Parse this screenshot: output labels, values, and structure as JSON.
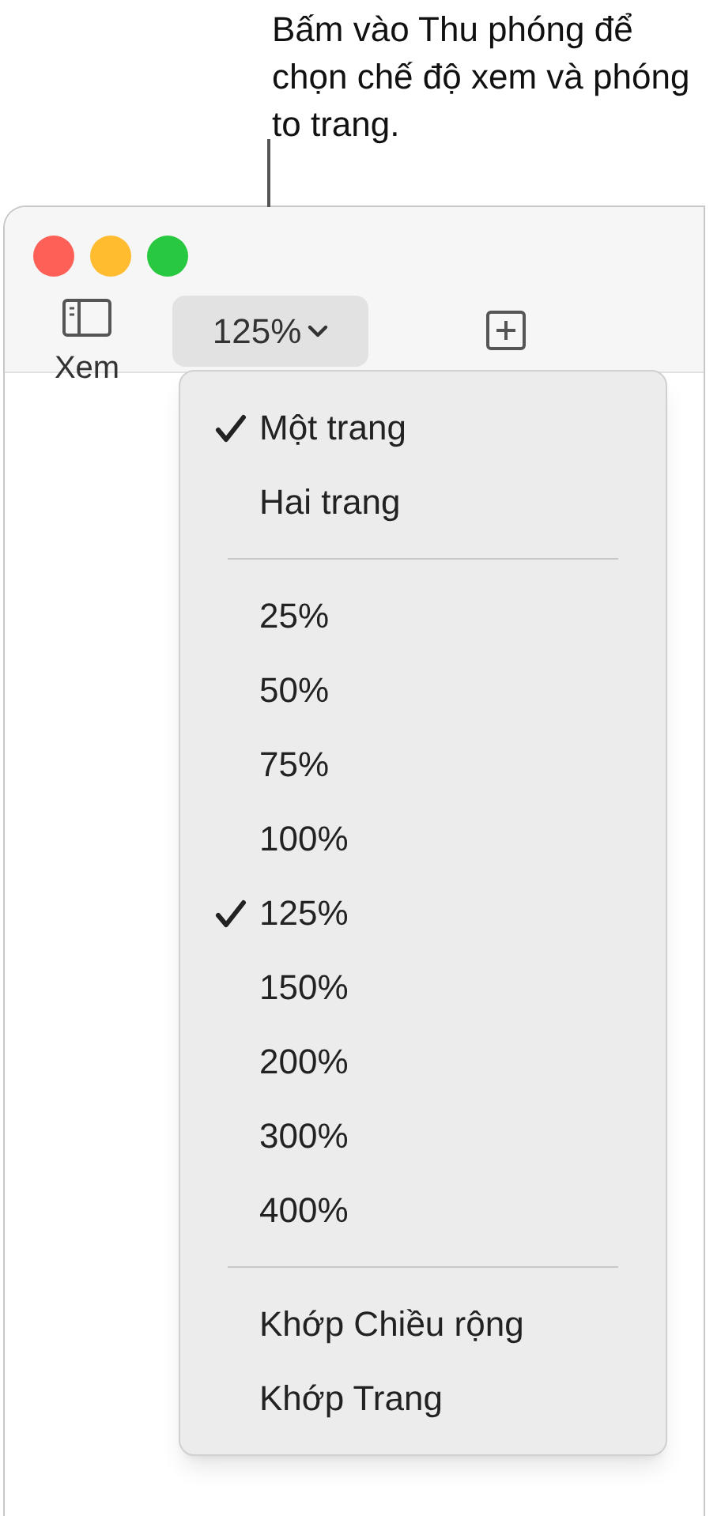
{
  "callout": {
    "text": "Bấm vào Thu phóng để chọn chế độ xem và phóng to trang."
  },
  "toolbar": {
    "view_button": {
      "label": "Xem"
    },
    "zoom_button": {
      "label": "125%"
    }
  },
  "menu": {
    "items": [
      {
        "kind": "item",
        "label": "Một trang",
        "checked": true
      },
      {
        "kind": "item",
        "label": "Hai trang",
        "checked": false
      },
      {
        "kind": "separator"
      },
      {
        "kind": "item",
        "label": "25%",
        "checked": false
      },
      {
        "kind": "item",
        "label": "50%",
        "checked": false
      },
      {
        "kind": "item",
        "label": "75%",
        "checked": false
      },
      {
        "kind": "item",
        "label": "100%",
        "checked": false
      },
      {
        "kind": "item",
        "label": "125%",
        "checked": true
      },
      {
        "kind": "item",
        "label": "150%",
        "checked": false
      },
      {
        "kind": "item",
        "label": "200%",
        "checked": false
      },
      {
        "kind": "item",
        "label": "300%",
        "checked": false
      },
      {
        "kind": "item",
        "label": "400%",
        "checked": false
      },
      {
        "kind": "separator"
      },
      {
        "kind": "item",
        "label": "Khớp Chiều rộng",
        "checked": false
      },
      {
        "kind": "item",
        "label": "Khớp Trang",
        "checked": false
      }
    ]
  }
}
